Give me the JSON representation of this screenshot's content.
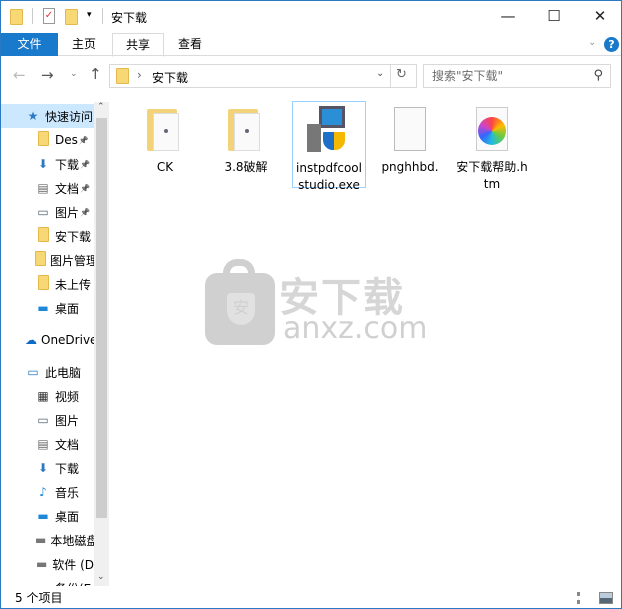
{
  "window": {
    "title": "安下载",
    "minimize": "—",
    "maximize": "☐",
    "close": "✕"
  },
  "ribbon": {
    "tabs": [
      {
        "label": "文件",
        "active": true
      },
      {
        "label": "主页"
      },
      {
        "label": "共享",
        "selected": true
      },
      {
        "label": "查看"
      }
    ],
    "help": "?"
  },
  "address": {
    "path": "安下载",
    "separator": "›"
  },
  "search": {
    "placeholder": "搜索\"安下载\""
  },
  "nav": {
    "items": [
      {
        "label": "快速访问",
        "icon": "star-icon",
        "selected": true,
        "level": 0
      },
      {
        "label": "Des",
        "icon": "folder-icon",
        "pinned": true,
        "level": 1
      },
      {
        "label": "下载",
        "icon": "download-icon",
        "pinned": true,
        "level": 1
      },
      {
        "label": "文档",
        "icon": "document-icon",
        "pinned": true,
        "level": 1
      },
      {
        "label": "图片",
        "icon": "picture-icon",
        "pinned": true,
        "level": 1
      },
      {
        "label": "安下载",
        "icon": "folder-icon",
        "level": 1
      },
      {
        "label": "图片管理",
        "icon": "folder-icon",
        "level": 1
      },
      {
        "label": "未上传",
        "icon": "folder-icon",
        "level": 1
      },
      {
        "label": "桌面",
        "icon": "desktop-icon",
        "level": 1
      },
      {
        "label": "OneDrive",
        "icon": "cloud-icon",
        "level": 0
      },
      {
        "label": "此电脑",
        "icon": "computer-icon",
        "level": 0
      },
      {
        "label": "视频",
        "icon": "video-icon",
        "level": 1
      },
      {
        "label": "图片",
        "icon": "picture-icon",
        "level": 1
      },
      {
        "label": "文档",
        "icon": "document-icon",
        "level": 1
      },
      {
        "label": "下载",
        "icon": "download-icon",
        "level": 1
      },
      {
        "label": "音乐",
        "icon": "music-icon",
        "level": 1
      },
      {
        "label": "桌面",
        "icon": "desktop-icon",
        "level": 1
      },
      {
        "label": "本地磁盘",
        "icon": "drive-icon",
        "level": 1
      },
      {
        "label": "软件 (D",
        "icon": "drive-icon",
        "level": 1
      },
      {
        "label": "备份(E",
        "icon": "drive-icon",
        "level": 1
      }
    ]
  },
  "files": [
    {
      "name": "CK",
      "icon": "folder-icon"
    },
    {
      "name": "3.8破解",
      "icon": "folder-icon"
    },
    {
      "name": "instpdfcoolstudio.exe",
      "icon": "installer-icon",
      "selected": true
    },
    {
      "name": "pnghhbd.",
      "icon": "blank-file-icon"
    },
    {
      "name": "安下载帮助.htm",
      "icon": "html-file-icon"
    }
  ],
  "watermark": {
    "cn": "安下载",
    "domain": "anxz.com",
    "badge": "安"
  },
  "status": {
    "count": "5 个项目"
  },
  "colors": {
    "accent": "#1979ca",
    "selection_border": "#99d1ff",
    "nav_selected": "#cce8ff"
  }
}
